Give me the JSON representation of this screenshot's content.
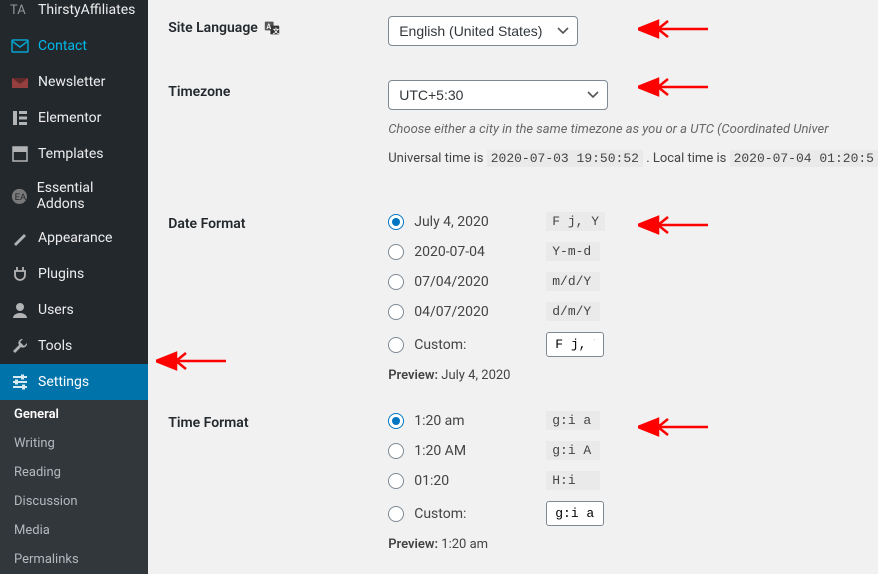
{
  "sidebar": {
    "items": [
      {
        "label": "ThirstyAffiliates"
      },
      {
        "label": "Contact"
      },
      {
        "label": "Newsletter"
      },
      {
        "label": "Elementor"
      },
      {
        "label": "Templates"
      },
      {
        "label": "Essential Addons"
      },
      {
        "label": "Appearance"
      },
      {
        "label": "Plugins"
      },
      {
        "label": "Users"
      },
      {
        "label": "Tools"
      },
      {
        "label": "Settings"
      }
    ],
    "submenu": [
      {
        "label": "General"
      },
      {
        "label": "Writing"
      },
      {
        "label": "Reading"
      },
      {
        "label": "Discussion"
      },
      {
        "label": "Media"
      },
      {
        "label": "Permalinks"
      }
    ]
  },
  "labels": {
    "site_language": "Site Language",
    "timezone": "Timezone",
    "date_format": "Date Format",
    "time_format": "Time Format"
  },
  "site_language": {
    "value": "English (United States)"
  },
  "timezone": {
    "value": "UTC+5:30",
    "description": "Choose either a city in the same timezone as you or a UTC (Coordinated Univer",
    "universal_label": "Universal time is",
    "universal_value": "2020-07-03 19:50:52",
    "local_label": ". Local time is",
    "local_value": "2020-07-04 01:20:5"
  },
  "date_format": {
    "options": [
      {
        "label": "July 4, 2020",
        "code": "F j, Y"
      },
      {
        "label": "2020-07-04",
        "code": "Y-m-d"
      },
      {
        "label": "07/04/2020",
        "code": "m/d/Y"
      },
      {
        "label": "04/07/2020",
        "code": "d/m/Y"
      }
    ],
    "custom_label": "Custom:",
    "custom_value": "F j, Y",
    "preview_label": "Preview:",
    "preview_value": "July 4, 2020"
  },
  "time_format": {
    "options": [
      {
        "label": "1:20 am",
        "code": "g:i a"
      },
      {
        "label": "1:20 AM",
        "code": "g:i A"
      },
      {
        "label": "01:20",
        "code": "H:i"
      }
    ],
    "custom_label": "Custom:",
    "custom_value": "g:i a",
    "preview_label": "Preview:",
    "preview_value": "1:20 am"
  }
}
